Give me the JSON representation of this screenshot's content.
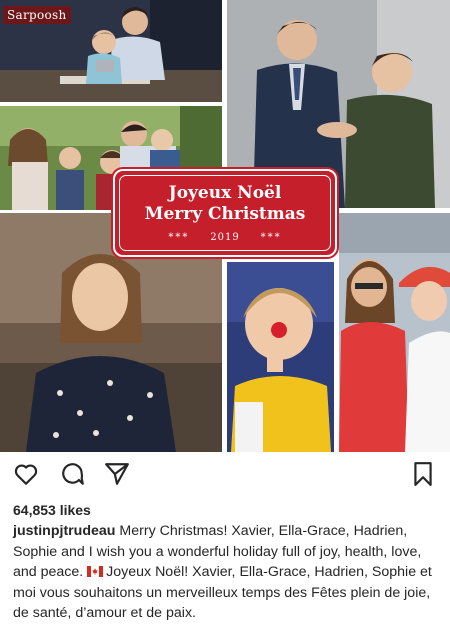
{
  "watermark": {
    "text": "Sarpoosh"
  },
  "card": {
    "line1": "Joyeux Noël",
    "line2": "Merry Christmas",
    "stars_left": "***",
    "year": "2019",
    "stars_right": "***",
    "bg_color": "#c41f2b"
  },
  "actions": {
    "like_icon": "heart-icon",
    "comment_icon": "comment-icon",
    "share_icon": "send-icon",
    "save_icon": "bookmark-icon"
  },
  "post": {
    "likes": "64,853 likes",
    "username": "justinpjtrudeau",
    "caption_en": "Merry Christmas! Xavier, Ella-Grace, Hadrien, Sophie and I wish you a wonderful holiday full of joy, health, love, and peace.",
    "flag_icon": "canada-flag-icon",
    "caption_fr": "Joyeux Noël! Xavier, Ella-Grace, Hadrien, Sophie et moi vous souhaitons un merveilleux temps des Fêtes plein de joie, de santé, d’amour et de paix."
  }
}
